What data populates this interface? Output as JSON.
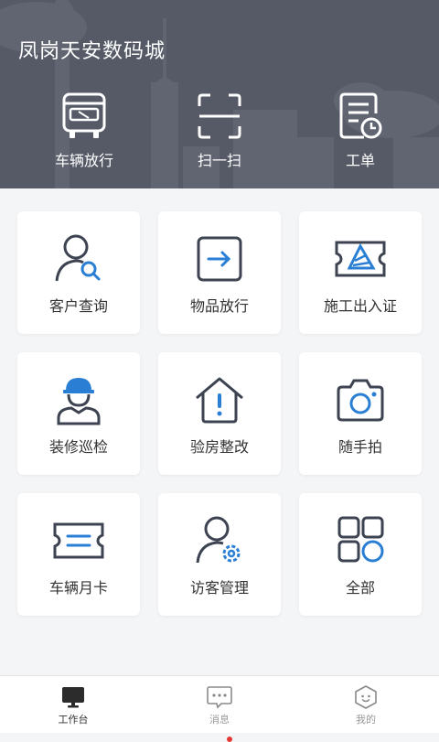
{
  "header": {
    "title": "凤岗天安数码城",
    "quick_actions": [
      {
        "label": "车辆放行",
        "icon": "bus-icon"
      },
      {
        "label": "扫一扫",
        "icon": "scan-icon"
      },
      {
        "label": "工单",
        "icon": "work-order-icon"
      }
    ]
  },
  "grid": [
    {
      "label": "客户查询",
      "icon": "customer-search-icon"
    },
    {
      "label": "物品放行",
      "icon": "item-release-icon"
    },
    {
      "label": "施工出入证",
      "icon": "construction-pass-icon"
    },
    {
      "label": "装修巡检",
      "icon": "renovation-inspection-icon"
    },
    {
      "label": "验房整改",
      "icon": "house-inspection-icon"
    },
    {
      "label": "随手拍",
      "icon": "camera-icon"
    },
    {
      "label": "车辆月卡",
      "icon": "monthly-card-icon"
    },
    {
      "label": "访客管理",
      "icon": "visitor-management-icon"
    },
    {
      "label": "全部",
      "icon": "all-apps-icon"
    }
  ],
  "tabbar": {
    "items": [
      {
        "label": "工作台",
        "icon": "workbench-icon",
        "active": true
      },
      {
        "label": "消息",
        "icon": "message-icon",
        "active": false
      },
      {
        "label": "我的",
        "icon": "profile-icon",
        "active": false
      }
    ]
  },
  "colors": {
    "header_bg": "#555a66",
    "icon_dark": "#3d4351",
    "icon_accent": "#2a7fd4",
    "tab_active": "#333333",
    "tab_inactive": "#999999",
    "badge": "#e53935"
  }
}
